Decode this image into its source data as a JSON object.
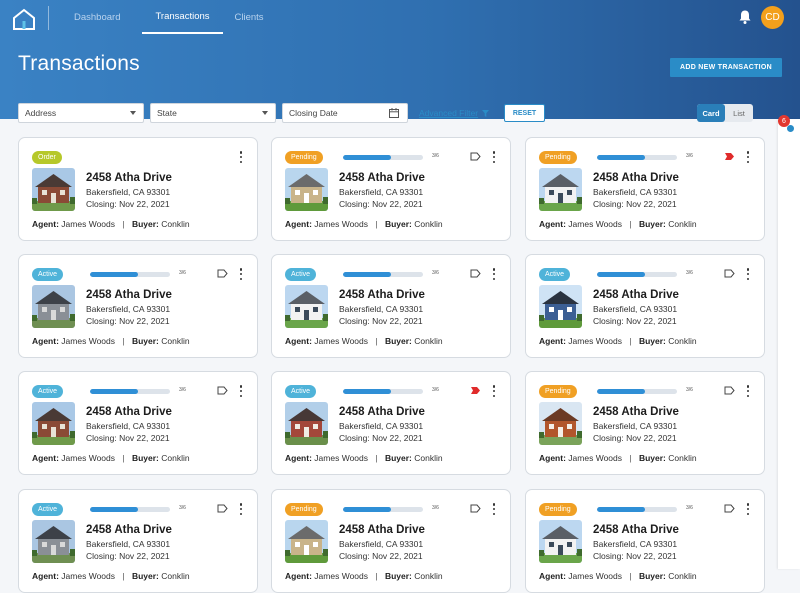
{
  "header": {
    "nav": [
      "Dashboard",
      "Transactions",
      "Clients"
    ],
    "user_initials": "CD",
    "page_title": "Transactions",
    "add_button": "ADD NEW TRANSACTION"
  },
  "filters": {
    "address": "Address",
    "state": "State",
    "closing_date": "Closing Date",
    "advanced": "Advanced Filter",
    "reset": "RESET",
    "view_card": "Card",
    "view_list": "List"
  },
  "notifications": {
    "count": "6"
  },
  "labels": {
    "agent": "Agent:",
    "buyer": "Buyer:",
    "separator": "|"
  },
  "colors": {
    "accent": "#2a8cc7",
    "order": "#b6c82a",
    "pending": "#f0a024",
    "active": "#4fb3d9",
    "flag_red": "#e02b2b"
  },
  "cards": [
    {
      "status": "Order",
      "progress": null,
      "ratio": "",
      "flag": "none",
      "address": "2458 Atha Drive",
      "city": "Bakersfield, CA 93301",
      "closing": "Closing: Nov 22, 2021",
      "agent": "James Woods",
      "buyer": "Conklin",
      "house": "brick"
    },
    {
      "status": "Pending",
      "progress": 0.6,
      "ratio": "3/6",
      "flag": "outline",
      "address": "2458 Atha Drive",
      "city": "Bakersfield, CA 93301",
      "closing": "Closing: Nov 22, 2021",
      "agent": "James Woods",
      "buyer": "Conklin",
      "house": "green"
    },
    {
      "status": "Pending",
      "progress": 0.6,
      "ratio": "3/6",
      "flag": "red",
      "address": "2458 Atha Drive",
      "city": "Bakersfield, CA 93301",
      "closing": "Closing: Nov 22, 2021",
      "agent": "James Woods",
      "buyer": "Conklin",
      "house": "white"
    },
    {
      "status": "Active",
      "progress": 0.6,
      "ratio": "3/6",
      "flag": "outline",
      "address": "2458 Atha Drive",
      "city": "Bakersfield, CA 93301",
      "closing": "Closing: Nov 22, 2021",
      "agent": "James Woods",
      "buyer": "Conklin",
      "house": "grey"
    },
    {
      "status": "Active",
      "progress": 0.6,
      "ratio": "3/6",
      "flag": "outline",
      "address": "2458 Atha Drive",
      "city": "Bakersfield, CA 93301",
      "closing": "Closing: Nov 22, 2021",
      "agent": "James Woods",
      "buyer": "Conklin",
      "house": "white"
    },
    {
      "status": "Active",
      "progress": 0.6,
      "ratio": "3/6",
      "flag": "outline",
      "address": "2458 Atha Drive",
      "city": "Bakersfield, CA 93301",
      "closing": "Closing: Nov 22, 2021",
      "agent": "James Woods",
      "buyer": "Conklin",
      "house": "blue"
    },
    {
      "status": "Active",
      "progress": 0.6,
      "ratio": "3/6",
      "flag": "outline",
      "address": "2458 Atha Drive",
      "city": "Bakersfield, CA 93301",
      "closing": "Closing: Nov 22, 2021",
      "agent": "James Woods",
      "buyer": "Conklin",
      "house": "brick"
    },
    {
      "status": "Active",
      "progress": 0.6,
      "ratio": "3/6",
      "flag": "red",
      "address": "2458 Atha Drive",
      "city": "Bakersfield, CA 93301",
      "closing": "Closing: Nov 22, 2021",
      "agent": "James Woods",
      "buyer": "Conklin",
      "house": "red"
    },
    {
      "status": "Pending",
      "progress": 0.6,
      "ratio": "3/6",
      "flag": "outline",
      "address": "2458 Atha Drive",
      "city": "Bakersfield, CA 93301",
      "closing": "Closing: Nov 22, 2021",
      "agent": "James Woods",
      "buyer": "Conklin",
      "house": "orange"
    },
    {
      "status": "Active",
      "progress": 0.6,
      "ratio": "3/6",
      "flag": "outline",
      "address": "2458 Atha Drive",
      "city": "Bakersfield, CA 93301",
      "closing": "Closing: Nov 22, 2021",
      "agent": "James Woods",
      "buyer": "Conklin",
      "house": "grey"
    },
    {
      "status": "Pending",
      "progress": 0.6,
      "ratio": "3/6",
      "flag": "outline",
      "address": "2458 Atha Drive",
      "city": "Bakersfield, CA 93301",
      "closing": "Closing: Nov 22, 2021",
      "agent": "James Woods",
      "buyer": "Conklin",
      "house": "green"
    },
    {
      "status": "Pending",
      "progress": 0.6,
      "ratio": "3/6",
      "flag": "outline",
      "address": "2458 Atha Drive",
      "city": "Bakersfield, CA 93301",
      "closing": "Closing: Nov 22, 2021",
      "agent": "James Woods",
      "buyer": "Conklin",
      "house": "white"
    }
  ]
}
